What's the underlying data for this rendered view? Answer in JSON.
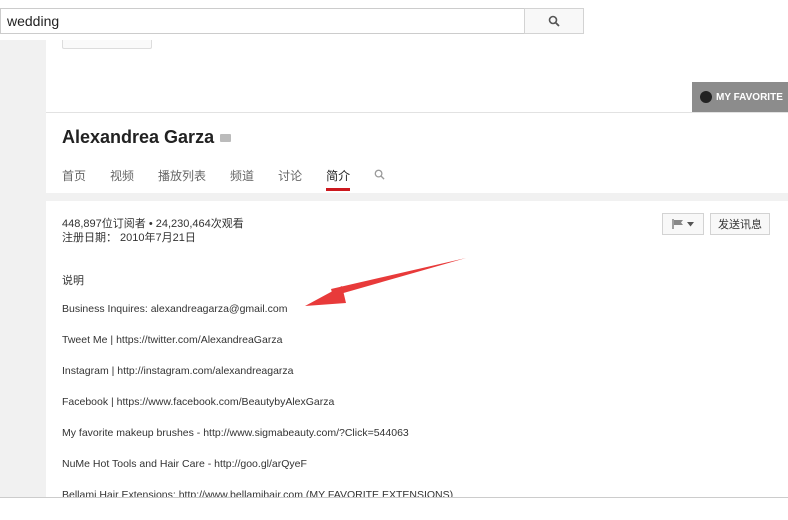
{
  "search": {
    "value": "wedding"
  },
  "banner": {
    "favorite_label": "MY FAVORITE"
  },
  "channel": {
    "name": "Alexandrea Garza",
    "tabs": [
      {
        "label": "首页"
      },
      {
        "label": "视频"
      },
      {
        "label": "播放列表"
      },
      {
        "label": "频道"
      },
      {
        "label": "讨论"
      },
      {
        "label": "简介",
        "active": true
      }
    ]
  },
  "about": {
    "stats": "448,897位订阅者 • 24,230,464次观看",
    "joined": "注册日期： 2010年7月21日",
    "send_message_label": "发送讯息",
    "description_title": "说明",
    "description_lines": [
      "Business Inquires: alexandreagarza@gmail.com",
      "Tweet Me | https://twitter.com/AlexandreaGarza",
      "Instagram | http://instagram.com/alexandreagarza",
      "Facebook | https://www.facebook.com/BeautybyAlexGarza",
      "My favorite makeup brushes - http://www.sigmabeauty.com/?Click=544063",
      "NuMe Hot Tools and Hair Care - http://goo.gl/arQyeF",
      "Bellami Hair Extensions: http://www.bellamihair.com (MY FAVORITE EXTENSIONS)"
    ]
  },
  "colors": {
    "accent_red": "#cc181e",
    "annotation_arrow": "#e83a3a",
    "favorite_button_bg": "#8c8c8c"
  },
  "icons": [
    "search-icon",
    "verified-badge-icon",
    "flag-icon",
    "dropdown-caret-icon",
    "annotation-arrow"
  ]
}
